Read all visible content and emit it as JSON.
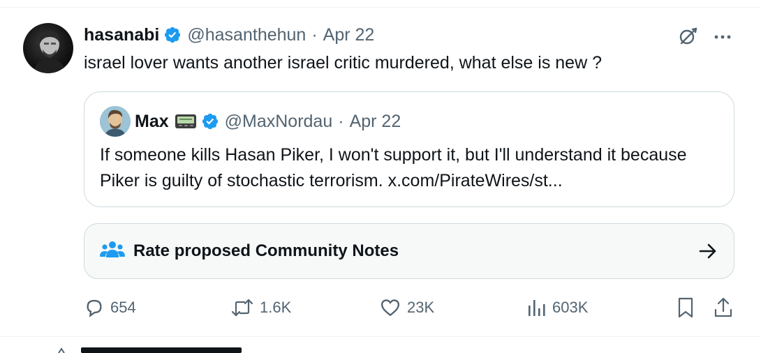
{
  "tweet": {
    "author": {
      "name": "hasanabi",
      "handle": "@hasanthehun",
      "date": "Apr 22",
      "separator": "·",
      "verified": true,
      "avatar_icon": "avatar-photo"
    },
    "text": "israel lover wants another israel critic murdered, what else is new ?",
    "menu_icon": "more-icon",
    "grok_icon": "grok-icon"
  },
  "quote": {
    "author": {
      "name": "Max",
      "handle": "@MaxNordau",
      "date": "Apr 22",
      "separator": "·",
      "verified": true,
      "badge_icon": "pager-icon"
    },
    "text": "If someone kills Hasan Piker, I won't support it, but I'll understand it because Piker is guilty of stochastic terrorism. x.com/PirateWires/st..."
  },
  "community_notes": {
    "label": "Rate proposed Community Notes",
    "icon": "community-notes-icon",
    "arrow_icon": "arrow-right-icon"
  },
  "actions": {
    "replies": "654",
    "reposts": "1.6K",
    "likes": "23K",
    "views": "603K"
  },
  "colors": {
    "text_primary": "#0f1419",
    "text_secondary": "#536471",
    "verified_blue": "#1d9bf0",
    "border": "#cfd9de",
    "notes_bg": "#f7f9f9"
  }
}
